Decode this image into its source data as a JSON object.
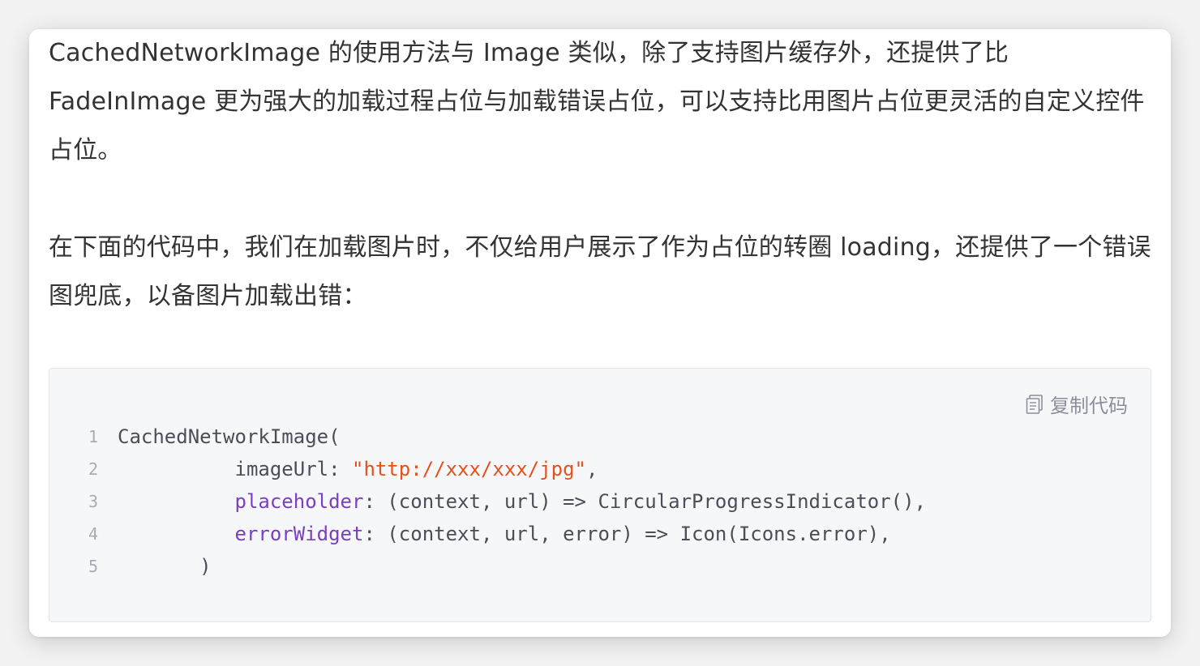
{
  "paragraphs": [
    "CachedNetworkImage 的使用方法与 Image 类似，除了支持图片缓存外，还提供了比 FadeInImage 更为强大的加载过程占位与加载错误占位，可以支持比用图片占位更灵活的自定义控件占位。",
    "在下面的代码中，我们在加载图片时，不仅给用户展示了作为占位的转圈 loading，还提供了一个错误图兜底，以备图片加载出错："
  ],
  "code_block": {
    "copy_label": "复制代码",
    "copy_icon": "copy-icon",
    "lines": [
      {
        "num": "1",
        "indent": "",
        "parts": [
          {
            "t": "CachedNetworkImage(",
            "c": "plain"
          }
        ]
      },
      {
        "num": "2",
        "indent": "          ",
        "parts": [
          {
            "t": "imageUrl: ",
            "c": "plain"
          },
          {
            "t": "\"http://xxx/xxx/jpg\"",
            "c": "str"
          },
          {
            "t": ",",
            "c": "plain"
          }
        ]
      },
      {
        "num": "3",
        "indent": "          ",
        "parts": [
          {
            "t": "placeholder",
            "c": "prop"
          },
          {
            "t": ": (context, url) => CircularProgressIndicator(),",
            "c": "plain"
          }
        ]
      },
      {
        "num": "4",
        "indent": "          ",
        "parts": [
          {
            "t": "errorWidget",
            "c": "prop"
          },
          {
            "t": ": (context, url, error) => Icon(Icons.error),",
            "c": "plain"
          }
        ]
      },
      {
        "num": "5",
        "indent": "       ",
        "parts": [
          {
            "t": ")",
            "c": "plain"
          }
        ]
      }
    ]
  },
  "colors": {
    "string": "#e4511b",
    "property": "#7a3fc2",
    "code_text": "#4a4f57",
    "body_text": "#333333"
  }
}
